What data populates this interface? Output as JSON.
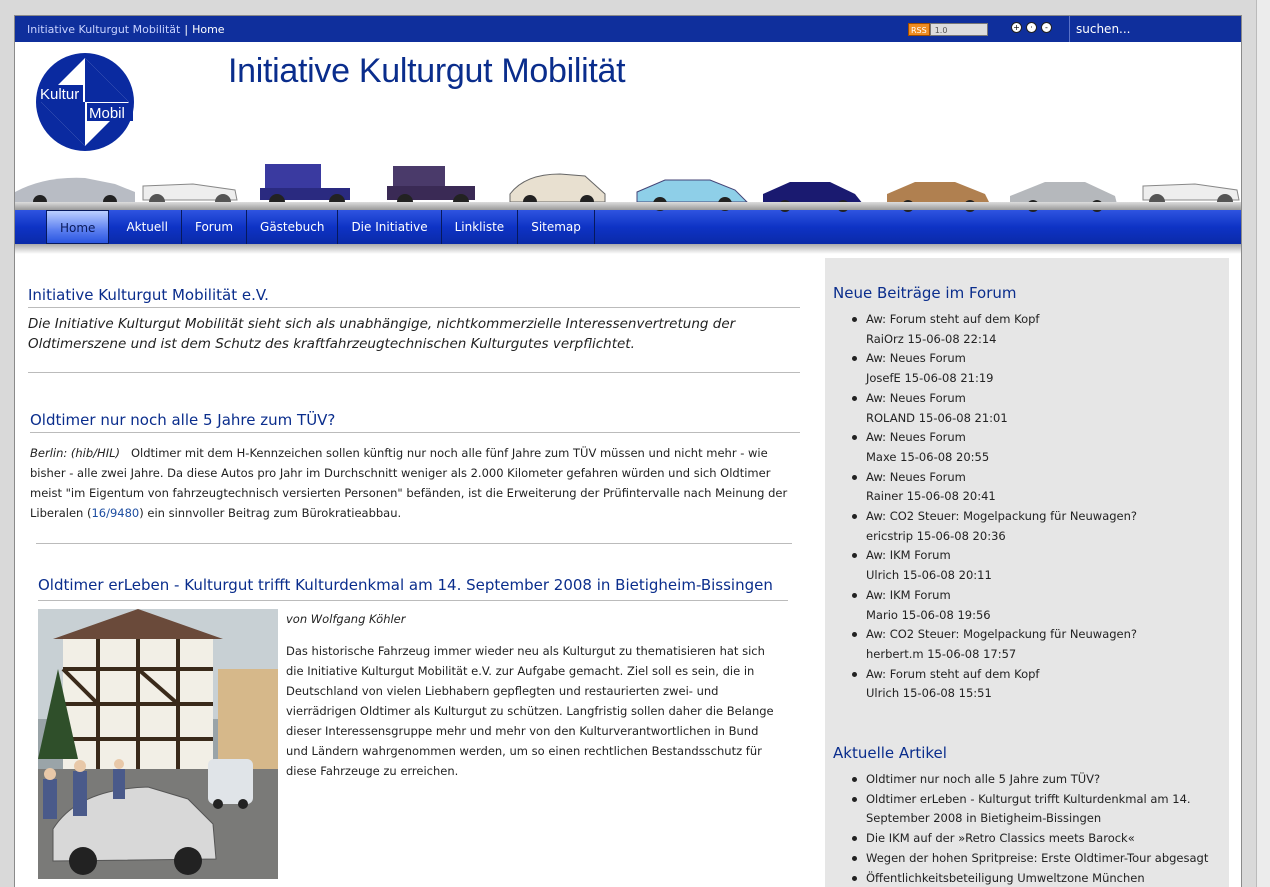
{
  "topbar": {
    "crumb_site": "Initiative Kulturgut Mobilität",
    "crumb_sep": "|",
    "crumb_home": "Home",
    "rss_left": "RSS",
    "rss_right": "1.0",
    "search_placeholder": "suchen..."
  },
  "header": {
    "title": "Initiative Kulturgut Mobilität",
    "logo_top": "Kultur",
    "logo_bottom": "Mobil"
  },
  "nav": {
    "items": [
      "Home",
      "Aktuell",
      "Forum",
      "Gästebuch",
      "Die Initiative",
      "Linkliste",
      "Sitemap"
    ]
  },
  "main": {
    "intro_title": "Initiative Kulturgut Mobilität e.V.",
    "intro_text": "Die Initiative Kulturgut Mobilität sieht sich als unabhängige, nichtkommerzielle Interessenvertretung der Oldtimerszene und ist dem Schutz des kraftfahrzeugtechnischen Kulturgutes verpflichtet.",
    "article1": {
      "title": "Oldtimer nur noch alle 5 Jahre zum TÜV?",
      "source": "Berlin: (hib/HIL)",
      "text_a": "Oldtimer mit dem H-Kennzeichen sollen künftig nur noch alle fünf Jahre zum TÜV müssen und nicht mehr - wie bisher - alle zwei Jahre. Da diese Autos pro Jahr im Durchschnitt weniger als 2.000 Kilometer gefahren würden und sich Oldtimer meist \"im Eigentum von fahrzeugtechnisch versierten Personen\" befänden, ist die Erweiterung der Prüfintervalle nach Meinung der Liberalen (",
      "link": "16/9480",
      "text_b": ") ein sinnvoller Beitrag zum Bürokratieabbau."
    },
    "article2": {
      "title": "Oldtimer erLeben - Kulturgut trifft Kulturdenkmal am 14. September 2008 in Bietigheim-Bissingen",
      "author": "von Wolfgang Köhler",
      "text": "Das historische Fahrzeug immer wieder neu als Kulturgut zu thematisieren hat sich die Initiative Kulturgut Mobilität e.V. zur Aufgabe gemacht. Ziel soll es sein, die in Deutschland von vielen Liebhabern gepflegten und restaurierten zwei- und vierrädrigen Oldtimer als Kulturgut zu schützen. Langfristig sollen daher die Belange dieser Interessensgruppe mehr und mehr von den Kulturverantwortlichen in Bund und Ländern wahrgenommen werden, um so einen rechtlichen Bestandsschutz für diese Fahrzeuge zu erreichen."
    }
  },
  "sidebar": {
    "forum_title": "Neue Beiträge im Forum",
    "forum_posts": [
      {
        "title": "Aw: Forum steht auf dem Kopf",
        "meta": "RaiOrz 15-06-08 22:14"
      },
      {
        "title": "Aw: Neues Forum",
        "meta": "JosefE 15-06-08 21:19"
      },
      {
        "title": "Aw: Neues Forum",
        "meta": "ROLAND 15-06-08 21:01"
      },
      {
        "title": "Aw: Neues Forum",
        "meta": "Maxe 15-06-08 20:55"
      },
      {
        "title": "Aw: Neues Forum",
        "meta": "Rainer 15-06-08 20:41"
      },
      {
        "title": "Aw: CO2 Steuer: Mogelpackung für Neuwagen?",
        "meta": "ericstrip 15-06-08 20:36"
      },
      {
        "title": "Aw: IKM Forum",
        "meta": "Ulrich 15-06-08 20:11"
      },
      {
        "title": "Aw: IKM Forum",
        "meta": "Mario 15-06-08 19:56"
      },
      {
        "title": "Aw: CO2 Steuer: Mogelpackung für Neuwagen?",
        "meta": "herbert.m 15-06-08 17:57"
      },
      {
        "title": "Aw: Forum steht auf dem Kopf",
        "meta": "Ulrich 15-06-08 15:51"
      }
    ],
    "articles_title": "Aktuelle Artikel",
    "articles": [
      "Oldtimer nur noch alle 5 Jahre zum TÜV?",
      "Oldtimer erLeben - Kulturgut trifft Kulturdenkmal am 14. September 2008 in Bietigheim-Bissingen",
      "Die IKM auf der »Retro Classics meets Barock«",
      "Wegen der hohen Spritpreise: Erste Oldtimer-Tour abgesagt",
      "Öffentlichkeitsbeteiligung Umweltzone München"
    ]
  },
  "colors": {
    "brand_blue": "#0a2d8c",
    "nav_blue": "#0e33c5",
    "topbar_blue": "#0f2f9c"
  }
}
